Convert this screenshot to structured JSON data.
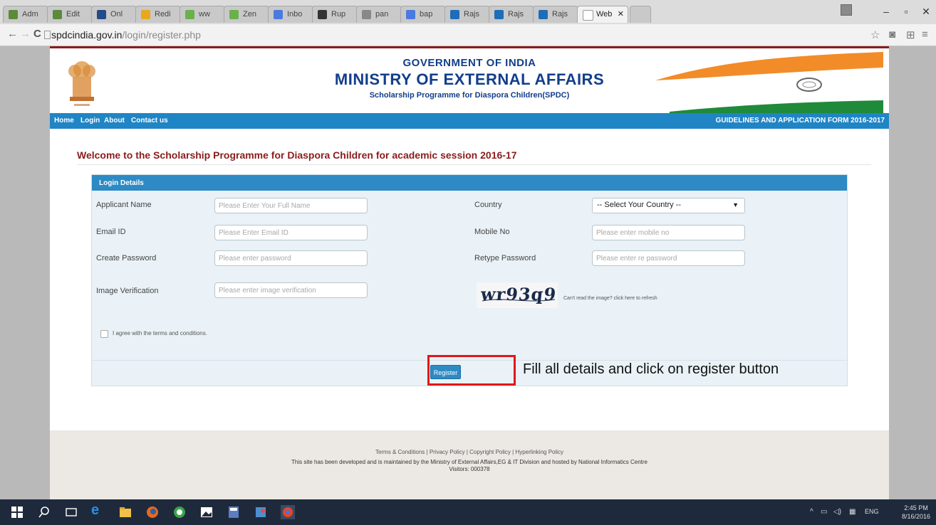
{
  "browser": {
    "tabs": [
      {
        "label": "Adm",
        "color": "#5a8a3a"
      },
      {
        "label": "Edit",
        "color": "#5a8a3a"
      },
      {
        "label": "Onl",
        "color": "#234a8a"
      },
      {
        "label": "Redi",
        "color": "#e7a81c"
      },
      {
        "label": "ww",
        "color": "#6ab04c"
      },
      {
        "label": "Zen",
        "color": "#6ab04c"
      },
      {
        "label": "Inbo",
        "color": "#4a7ae0"
      },
      {
        "label": "Rup",
        "color": "#333333"
      },
      {
        "label": "pan",
        "color": "#888888"
      },
      {
        "label": "bap",
        "color": "#4a7ae0"
      },
      {
        "label": "Rajs",
        "color": "#1e6db8"
      },
      {
        "label": "Rajs",
        "color": "#1e6db8"
      },
      {
        "label": "Rajs",
        "color": "#1e6db8"
      },
      {
        "label": "Web",
        "color": "#ffffff"
      }
    ],
    "url_domain": "spdcindia.gov.in",
    "url_path": "/login/register.php"
  },
  "header": {
    "gov": "GOVERNMENT OF INDIA",
    "ministry": "MINISTRY OF EXTERNAL AFFAIRS",
    "programme": "Scholarship Programme for Diaspora Children(SPDC)"
  },
  "nav": {
    "home": "Home",
    "login": "Login",
    "about": "About",
    "contact": "Contact us",
    "guidelines": "GUIDELINES AND APPLICATION FORM 2016-2017"
  },
  "welcome": "Welcome to the Scholarship Programme for Diaspora Children for academic session 2016-17",
  "form": {
    "header": "Login Details",
    "applicant_label": "Applicant Name",
    "applicant_placeholder": "Please Enter Your Full Name",
    "country_label": "Country",
    "country_value": "-- Select Your Country --",
    "email_label": "Email ID",
    "email_placeholder": "Please Enter Email ID",
    "mobile_label": "Mobile No",
    "mobile_placeholder": "Please enter mobile no",
    "password_label": "Create Password",
    "password_placeholder": "Please enter password",
    "retype_label": "Retype Password",
    "retype_placeholder": "Please enter re password",
    "image_label": "Image Verification",
    "image_placeholder": "Please enter image verification",
    "captcha_text": "wr93q9",
    "refresh_text": "Can't read the image? click here to refresh",
    "agree_text": "I agree with the terms and conditions.",
    "register_label": "Register"
  },
  "annotation": "Fill all details and click on register button",
  "footer": {
    "links": "Terms & Conditions | Privacy Policy | Copyright Policy | Hyperlinking Policy",
    "developed": "This site has been developed and is maintained by the Ministry of External Affairs,EG & IT Division and hosted by National Informatics Centre",
    "visitors": "Visitors: 000378"
  },
  "taskbar": {
    "lang": "ENG",
    "time": "2:45 PM",
    "date": "8/16/2016"
  }
}
